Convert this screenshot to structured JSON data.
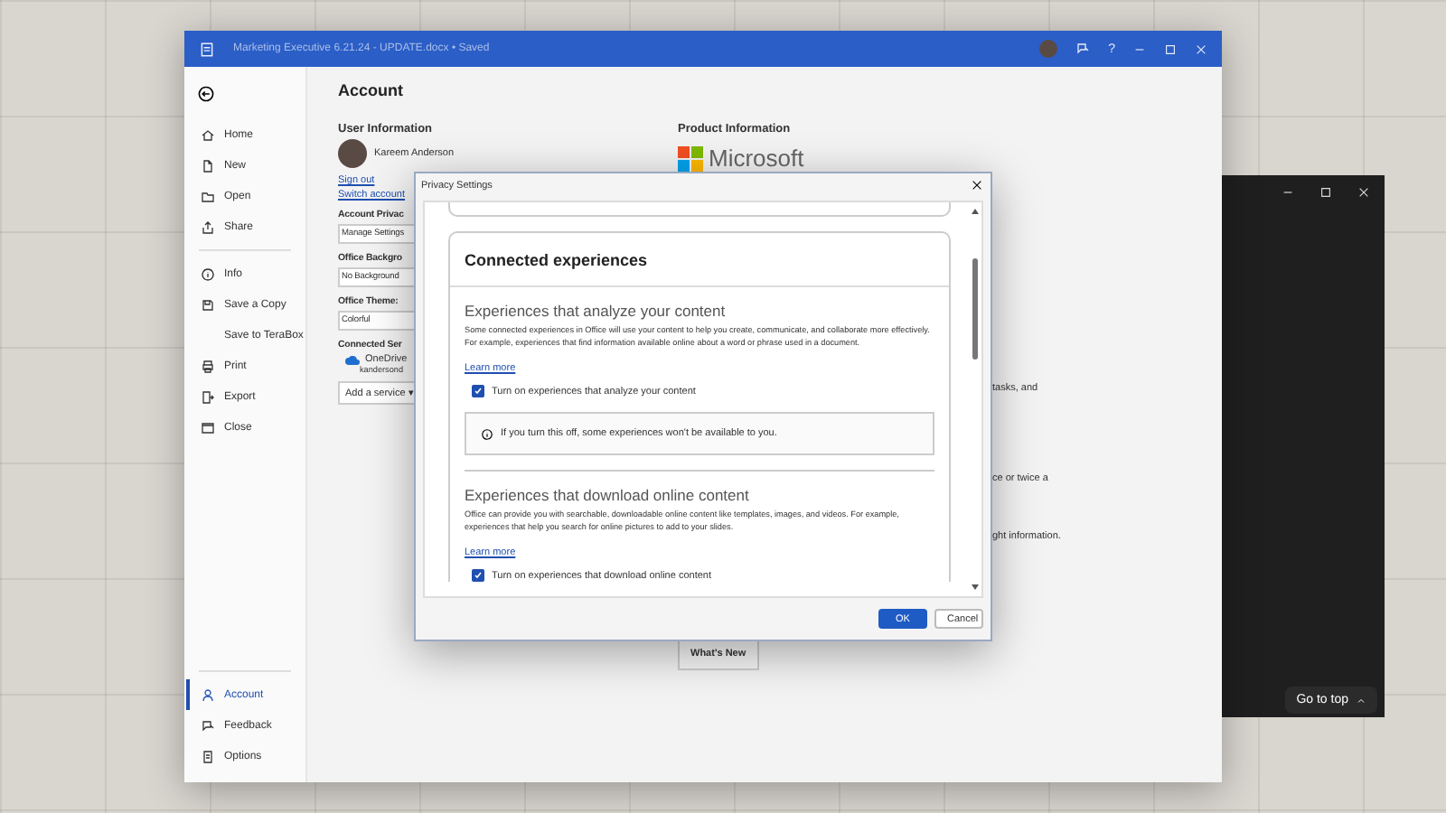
{
  "desktop": {
    "go_to_top": "Go to top"
  },
  "window": {
    "title": "Marketing Executive 6.21.24 - UPDATE.docx • Saved",
    "help": "?"
  },
  "sidebar": {
    "top_items": [
      {
        "label": "Home",
        "selected": false
      },
      {
        "label": "New",
        "selected": false
      },
      {
        "label": "Open",
        "selected": false
      },
      {
        "label": "Share",
        "selected": false
      }
    ],
    "middle_items": [
      {
        "label": "Info",
        "selected": false
      },
      {
        "label": "Save a Copy",
        "selected": false
      },
      {
        "label": "Save to TeraBox",
        "selected": false
      },
      {
        "label": "Print",
        "selected": false
      },
      {
        "label": "Export",
        "selected": false
      },
      {
        "label": "Close",
        "selected": false
      }
    ],
    "bottom_items": [
      {
        "label": "Account",
        "selected": true
      },
      {
        "label": "Feedback",
        "selected": false
      },
      {
        "label": "Options",
        "selected": false
      }
    ]
  },
  "account": {
    "heading": "Account",
    "user_info": {
      "heading": "User Information",
      "name": "Kareem Anderson",
      "sign_out": "Sign out",
      "switch_account": "Switch account"
    },
    "privacy": {
      "heading": "Account Privac",
      "button": "Manage Settings"
    },
    "background": {
      "heading": "Office Backgro",
      "value": "No Background"
    },
    "theme": {
      "heading": "Office Theme:",
      "value": "Colorful"
    },
    "services": {
      "heading": "Connected Ser",
      "service": "OneDrive",
      "email": "kandersond",
      "add_button": "Add a service ▾"
    },
    "product": {
      "heading": "Product Information",
      "logo_text": "Microsoft",
      "snippets": [
        "tasks, and",
        "ce or twice a",
        "ght information."
      ],
      "whats_new": "What's New"
    }
  },
  "dialog": {
    "title": "Privacy Settings",
    "card_title": "Connected experiences",
    "sections": [
      {
        "heading": "Experiences that analyze your content",
        "description": "Some connected experiences in Office will use your content to help you create, communicate, and collaborate more effectively. For example, experiences that find information available online about a word or phrase used in a document.",
        "learn_more": "Learn more",
        "checkbox": {
          "label": "Turn on experiences that analyze your content",
          "checked": true
        },
        "note": "If you turn this off, some experiences won't be available to you."
      },
      {
        "heading": "Experiences that download online content",
        "description": "Office can provide you with searchable, downloadable online content like templates, images, and videos. For example, experiences that help you search for online pictures to add to your slides.",
        "learn_more": "Learn more",
        "checkbox": {
          "label": "Turn on experiences that download online content",
          "checked": true
        }
      }
    ],
    "ok": "OK",
    "cancel": "Cancel"
  }
}
